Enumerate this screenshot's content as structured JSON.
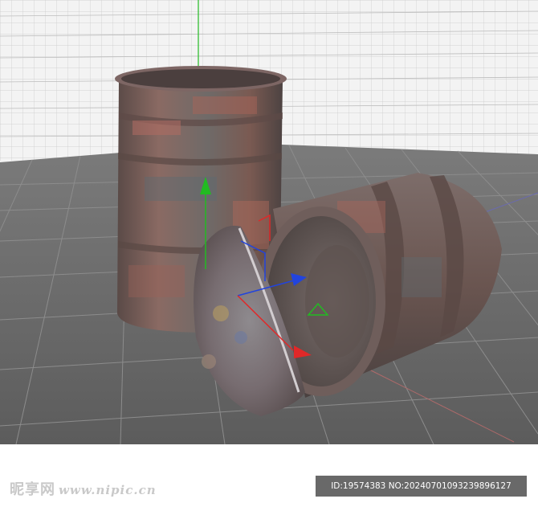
{
  "watermark": {
    "brand": "昵享网",
    "url": "www.nipic.cn"
  },
  "image_id": "ID:19574383 NO:20240701093239896127",
  "colors": {
    "grid_background": "#f2f2f2",
    "floor": "#6e6e6e",
    "axis_y": "#22bb22",
    "axis_x": "#e02828",
    "axis_z": "#2244dd",
    "rust": "#8a5048"
  },
  "icons": {
    "gizmo_y": "arrow-up-icon",
    "gizmo_x": "arrow-right-icon",
    "gizmo_z": "arrow-icon"
  }
}
